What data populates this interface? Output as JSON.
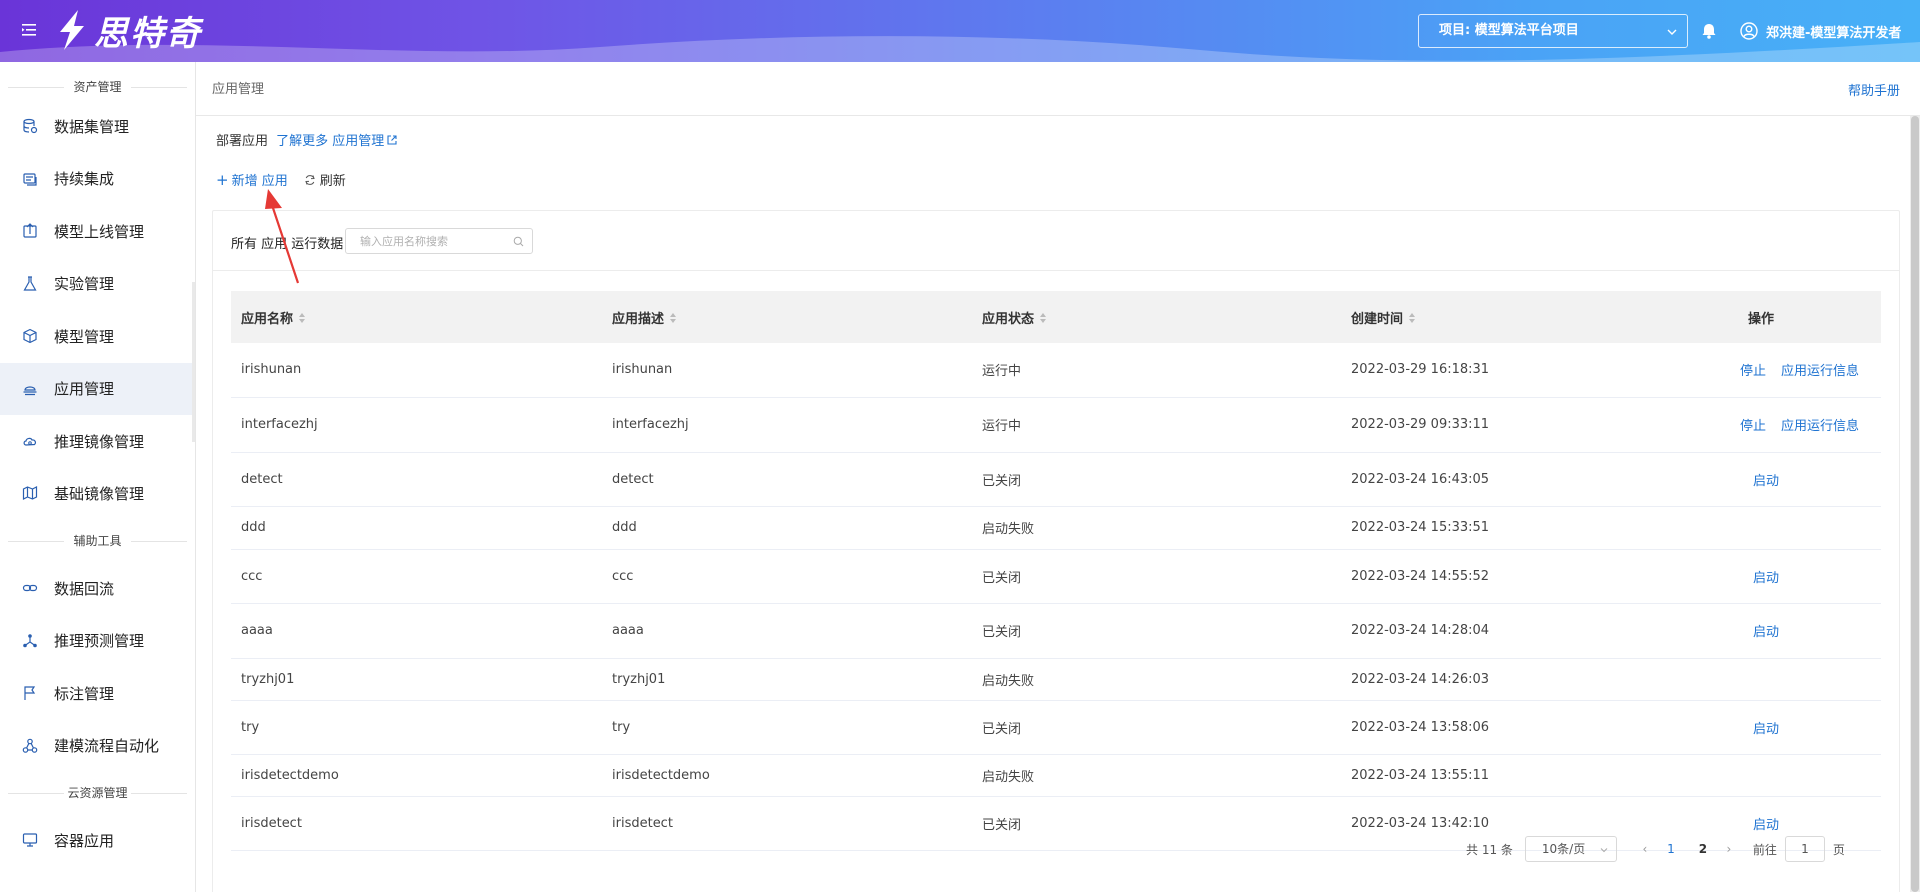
{
  "header": {
    "brand": "思特奇",
    "project": "项目: 模型算法平台项目",
    "user": "郑洪建-模型算法开发者"
  },
  "sidebar": {
    "sections": [
      {
        "title": "资产管理",
        "items": [
          {
            "label": "数据集管理",
            "icon": "database-icon"
          },
          {
            "label": "持续集成",
            "icon": "integration-icon"
          },
          {
            "label": "模型上线管理",
            "icon": "upload-icon"
          },
          {
            "label": "实验管理",
            "icon": "flask-icon"
          },
          {
            "label": "模型管理",
            "icon": "cube-icon"
          },
          {
            "label": "应用管理",
            "icon": "app-stack-icon",
            "active": true
          },
          {
            "label": "推理镜像管理",
            "icon": "cloud-icon"
          },
          {
            "label": "基础镜像管理",
            "icon": "image-icon"
          }
        ]
      },
      {
        "title": "辅助工具",
        "items": [
          {
            "label": "数据回流",
            "icon": "link-icon"
          },
          {
            "label": "推理预测管理",
            "icon": "network-icon"
          },
          {
            "label": "标注管理",
            "icon": "flag-icon"
          },
          {
            "label": "建模流程自动化",
            "icon": "flow-icon"
          }
        ]
      },
      {
        "title": "云资源管理",
        "items": [
          {
            "label": "容器应用",
            "icon": "monitor-icon"
          }
        ]
      }
    ]
  },
  "page": {
    "breadcrumb": "应用管理",
    "help": "帮助手册",
    "deploy_label": "部署应用",
    "deploy_link": "了解更多 应用管理",
    "add_label": "新增 应用",
    "refresh_label": "刷新",
    "panel_title": "所有 应用 运行数据",
    "search_placeholder": "输入应用名称搜索"
  },
  "table": {
    "columns": [
      "应用名称",
      "应用描述",
      "应用状态",
      "创建时间",
      "操作"
    ],
    "rows": [
      {
        "name": "irishunan",
        "desc": "irishunan",
        "status": "运行中",
        "time": "2022-03-29 16:18:31",
        "actions": [
          "停止",
          "应用运行信息"
        ]
      },
      {
        "name": "interfacezhj",
        "desc": "interfacezhj",
        "status": "运行中",
        "time": "2022-03-29 09:33:11",
        "actions": [
          "停止",
          "应用运行信息"
        ]
      },
      {
        "name": "detect",
        "desc": "detect",
        "status": "已关闭",
        "time": "2022-03-24 16:43:05",
        "actions": [
          "启动"
        ]
      },
      {
        "name": "ddd",
        "desc": "ddd",
        "status": "启动失败",
        "time": "2022-03-24 15:33:51",
        "actions": []
      },
      {
        "name": "ccc",
        "desc": "ccc",
        "status": "已关闭",
        "time": "2022-03-24 14:55:52",
        "actions": [
          "启动"
        ]
      },
      {
        "name": "aaaa",
        "desc": "aaaa",
        "status": "已关闭",
        "time": "2022-03-24 14:28:04",
        "actions": [
          "启动"
        ]
      },
      {
        "name": "tryzhj01",
        "desc": "tryzhj01",
        "status": "启动失败",
        "time": "2022-03-24 14:26:03",
        "actions": []
      },
      {
        "name": "try",
        "desc": "try",
        "status": "已关闭",
        "time": "2022-03-24 13:58:06",
        "actions": [
          "启动"
        ]
      },
      {
        "name": "irisdetectdemo",
        "desc": "irisdetectdemo",
        "status": "启动失败",
        "time": "2022-03-24 13:55:11",
        "actions": []
      },
      {
        "name": "irisdetect",
        "desc": "irisdetect",
        "status": "已关闭",
        "time": "2022-03-24 13:42:10",
        "actions": [
          "启动"
        ]
      }
    ]
  },
  "pagination": {
    "total": "共 11 条",
    "page_size": "10条/页",
    "pages": [
      "1",
      "2"
    ],
    "current": "1",
    "goto_label": "前往",
    "goto_value": "1",
    "page_suffix": "页"
  },
  "colors": {
    "accent": "#1f73d1",
    "header_start": "#6a34d8",
    "header_end": "#47b0f7",
    "annotation": "#e53935"
  }
}
